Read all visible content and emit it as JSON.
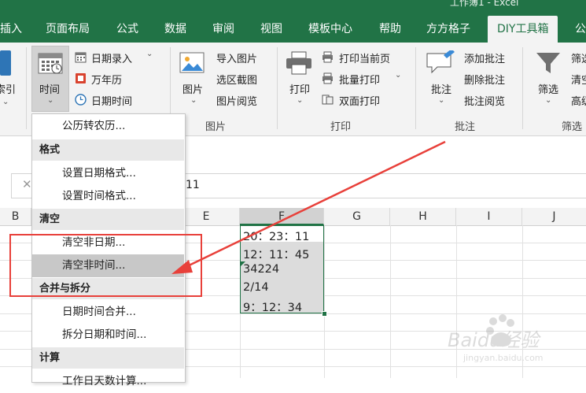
{
  "app": {
    "title": "工作簿1 - Excel"
  },
  "tabs": [
    {
      "label": "插入"
    },
    {
      "label": "页面布局"
    },
    {
      "label": "公式"
    },
    {
      "label": "数据"
    },
    {
      "label": "审阅"
    },
    {
      "label": "视图"
    },
    {
      "label": "模板中心"
    },
    {
      "label": "帮助"
    },
    {
      "label": "方方格子"
    },
    {
      "label": "DIY工具箱",
      "active": true
    },
    {
      "label": "公"
    }
  ],
  "ribbon": {
    "left_partial": "索引",
    "time_group": {
      "big_button": "时间",
      "date_entry": "日期录入",
      "calendar": "万年历",
      "datetime": "日期时间"
    },
    "picture_group": {
      "big_button": "图片",
      "import": "导入图片",
      "crop": "选区截图",
      "browse": "图片阅览",
      "label": "图片"
    },
    "print_group": {
      "big_button": "打印",
      "print_current": "打印当前页",
      "batch_print": "批量打印",
      "duplex_print": "双面打印",
      "label": "打印"
    },
    "comment_group": {
      "big_button": "批注",
      "add": "添加批注",
      "delete": "删除批注",
      "browse": "批注阅览",
      "label": "批注"
    },
    "filter_group": {
      "big_button": "筛选",
      "item1": "筛选",
      "item2": "清空",
      "item3": "高级",
      "label": "筛选"
    }
  },
  "formula_bar": {
    "cancel": "✕",
    "content": "11"
  },
  "columns": [
    "B",
    "C",
    "D",
    "E",
    "F",
    "G",
    "H",
    "I",
    "J"
  ],
  "cells": [
    "20：23：11",
    "12：11：45",
    "34224",
    "2/14",
    "9：12：34"
  ],
  "menu": {
    "top_item": "公历转农历...",
    "sections": [
      {
        "header": "格式",
        "items": [
          "设置日期格式...",
          "设置时间格式..."
        ]
      },
      {
        "header": "清空",
        "items": [
          "清空非日期...",
          "清空非时间..."
        ]
      },
      {
        "header": "合并与拆分",
        "items": [
          "日期时间合并...",
          "拆分日期和时间..."
        ]
      },
      {
        "header": "计算",
        "items": [
          "工作日天数计算..."
        ]
      }
    ]
  },
  "colors": {
    "excel_green": "#217346",
    "annotation_red": "#e8403a"
  },
  "watermark": {
    "brand": "Baidu经验",
    "url": "jingyan.baidu.com"
  }
}
